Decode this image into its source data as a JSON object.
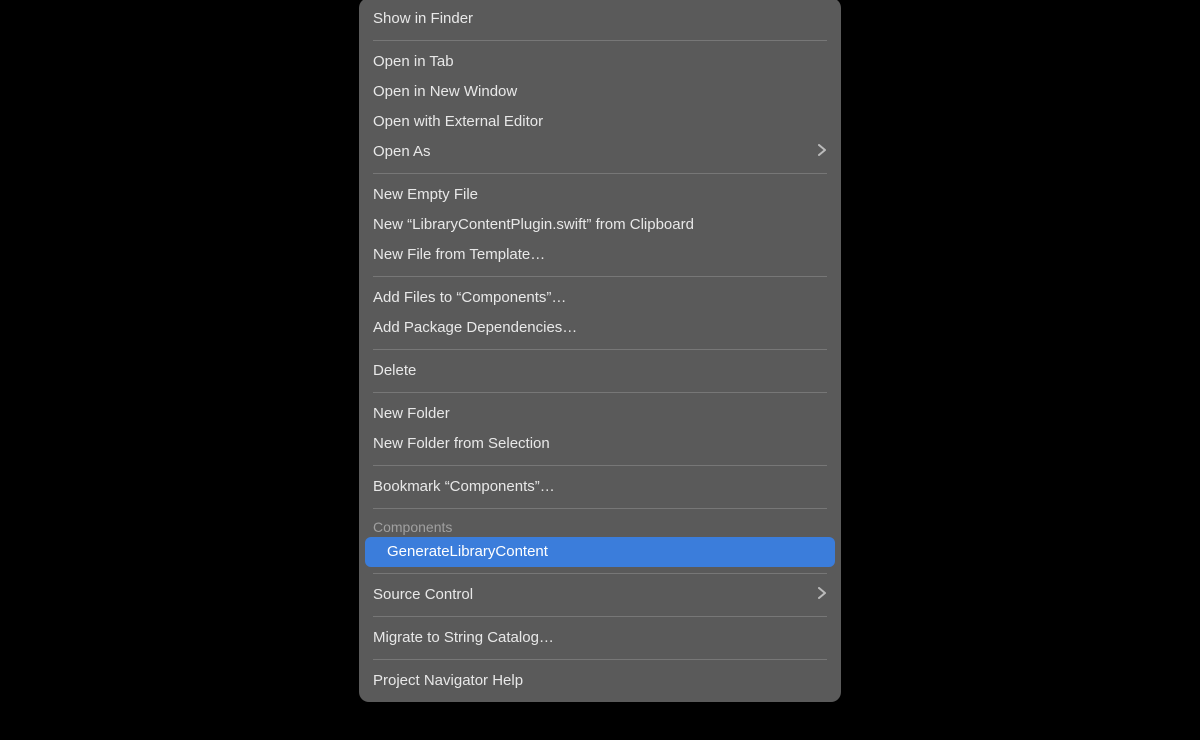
{
  "menu": {
    "group1": [
      {
        "label": "Show in Finder"
      }
    ],
    "group2": [
      {
        "label": "Open in Tab"
      },
      {
        "label": "Open in New Window"
      },
      {
        "label": "Open with External Editor"
      },
      {
        "label": "Open As",
        "submenu": true
      }
    ],
    "group3": [
      {
        "label": "New Empty File"
      },
      {
        "label": "New “LibraryContentPlugin.swift” from Clipboard"
      },
      {
        "label": "New File from Template…"
      }
    ],
    "group4": [
      {
        "label": "Add Files to “Components”…"
      },
      {
        "label": "Add Package Dependencies…"
      }
    ],
    "group5": [
      {
        "label": "Delete"
      }
    ],
    "group6": [
      {
        "label": "New Folder"
      },
      {
        "label": "New Folder from Selection"
      }
    ],
    "group7": [
      {
        "label": "Bookmark “Components”…"
      }
    ],
    "componentsHeader": "Components",
    "componentsItems": [
      {
        "label": "GenerateLibraryContent",
        "highlighted": true
      }
    ],
    "group8": [
      {
        "label": "Source Control",
        "submenu": true
      }
    ],
    "group9": [
      {
        "label": "Migrate to String Catalog…"
      }
    ],
    "group10": [
      {
        "label": "Project Navigator Help"
      }
    ]
  }
}
